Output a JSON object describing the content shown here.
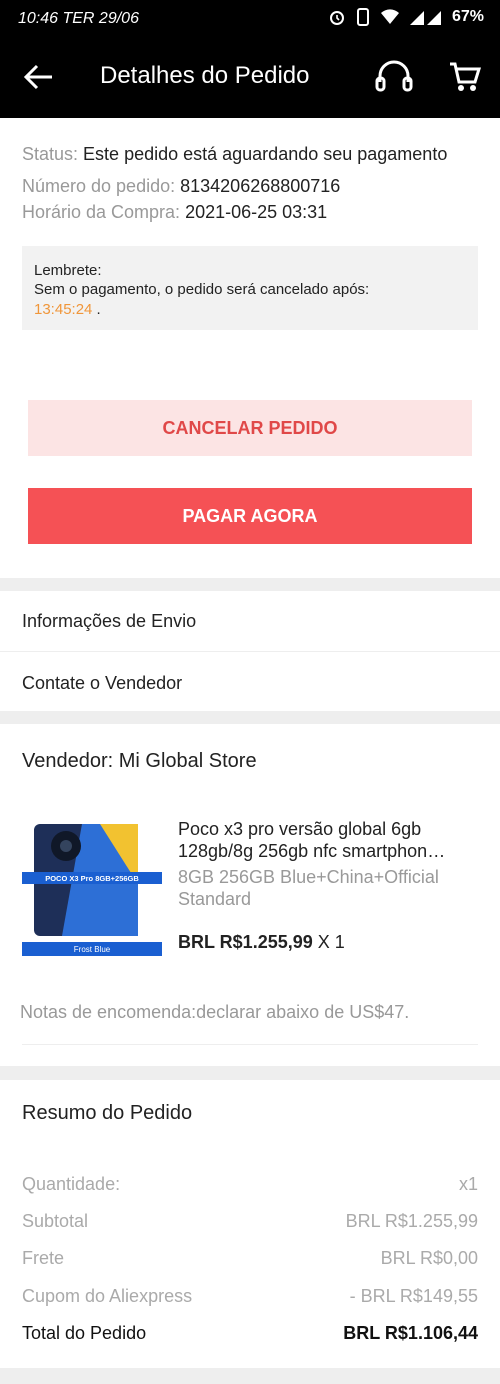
{
  "status_bar": {
    "time": "10:46 TER 29/06",
    "battery": "67%"
  },
  "header": {
    "title": "Detalhes do Pedido"
  },
  "order": {
    "status_label": "Status:",
    "status_value": "Este pedido está aguardando seu pagamento",
    "number_label": "Número do pedido:",
    "number_value": "8134206268800716",
    "time_label": "Horário da Compra:",
    "time_value": "2021-06-25 03:31"
  },
  "reminder": {
    "title": "Lembrete:",
    "text": "Sem o pagamento, o pedido será cancelado após:",
    "countdown": "13:45:24",
    "suffix": " ."
  },
  "actions": {
    "cancel": "CANCELAR PEDIDO",
    "pay": "PAGAR AGORA"
  },
  "links": {
    "shipping": "Informações de Envio",
    "contact": "Contate o Vendedor"
  },
  "seller": {
    "label": "Vendedor: Mi Global Store",
    "product_title": "Poco x3 pro versão global 6gb 128gb/8g 256gb nfc smartphon…",
    "variant": "8GB 256GB Blue+China+Official Standard",
    "price": "BRL R$1.255,99",
    "qty": " X 1",
    "image_banner": "POCO X3 Pro 8GB+256GB",
    "image_caption": "Frost Blue",
    "notes": "Notas de encomenda:declarar abaixo de US$47."
  },
  "summary": {
    "title": "Resumo do Pedido",
    "rows": [
      {
        "label": "Quantidade:",
        "value": "x1"
      },
      {
        "label": "Subtotal",
        "value": "BRL R$1.255,99"
      },
      {
        "label": "Frete",
        "value": "BRL R$0,00"
      },
      {
        "label": "Cupom do Aliexpress",
        "value": "- BRL R$149,55"
      }
    ],
    "total_label": "Total do Pedido",
    "total_value": "BRL R$1.106,44"
  },
  "colors": {
    "accent": "#f55155",
    "countdown": "#f0963a"
  }
}
